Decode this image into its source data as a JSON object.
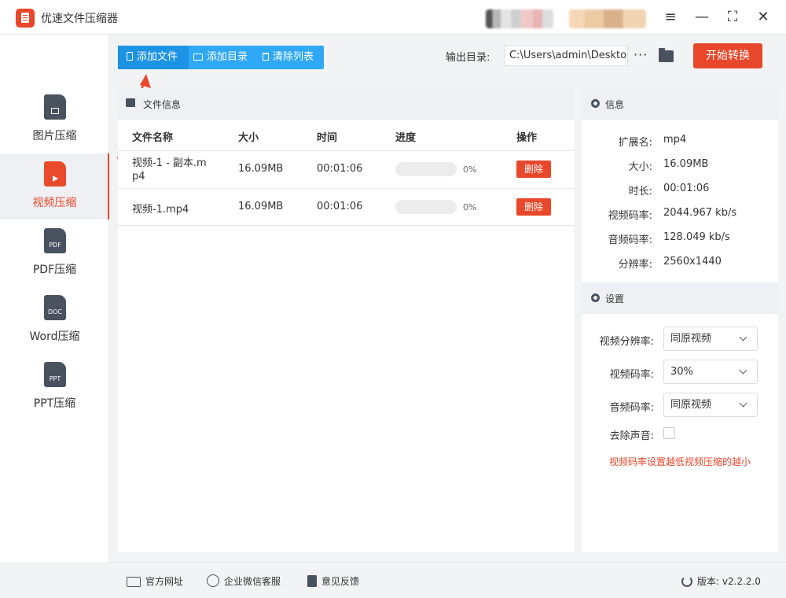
{
  "app": {
    "title": "优速文件压缩器"
  },
  "window": {
    "menu_icon": "≡",
    "minimize_icon": "—",
    "maximize_icon": "⛶",
    "close_icon": "✕"
  },
  "sidebar": {
    "items": [
      {
        "label": "图片压缩",
        "icon": "image-file-icon",
        "active": false
      },
      {
        "label": "视频压缩",
        "icon": "video-file-icon",
        "active": true
      },
      {
        "label": "PDF压缩",
        "icon": "pdf-file-icon",
        "tag": "PDF",
        "active": false
      },
      {
        "label": "Word压缩",
        "icon": "doc-file-icon",
        "tag": "DOC",
        "active": false
      },
      {
        "label": "PPT压缩",
        "icon": "ppt-file-icon",
        "tag": "PPT",
        "active": false
      }
    ]
  },
  "toolbar": {
    "add_file": "添加文件",
    "add_dir": "添加目录",
    "clear_list": "清除列表",
    "output_label": "输出目录:",
    "output_path": "C:\\Users\\admin\\Deskto",
    "more": "···",
    "start": "开始转换"
  },
  "file_panel": {
    "title": "文件信息",
    "columns": [
      "文件名称",
      "大小",
      "时间",
      "进度",
      "操作"
    ],
    "rows": [
      {
        "name_line1": "视频-1 - 副本.m",
        "name_line2": "p4",
        "size": "16.09MB",
        "time": "00:01:06",
        "progress": 0,
        "progress_text": "0%",
        "action": "删除"
      },
      {
        "name_line1": "视频-1.mp4",
        "size": "16.09MB",
        "time": "00:01:06",
        "progress": 0,
        "progress_text": "0%",
        "action": "删除"
      }
    ]
  },
  "info": {
    "title": "信息",
    "fields": [
      {
        "key": "扩展名:",
        "value": "mp4"
      },
      {
        "key": "大小:",
        "value": "16.09MB"
      },
      {
        "key": "时长:",
        "value": "00:01:06"
      },
      {
        "key": "视频码率:",
        "value": "2044.967 kb/s"
      },
      {
        "key": "音频码率:",
        "value": "128.049 kb/s"
      },
      {
        "key": "分辨率:",
        "value": "2560x1440"
      }
    ]
  },
  "settings": {
    "title": "设置",
    "video_resolution": {
      "label": "视频分辨率:",
      "value": "同原视频"
    },
    "video_bitrate": {
      "label": "视频码率:",
      "value": "30%"
    },
    "audio_bitrate": {
      "label": "音频码率:",
      "value": "同原视频"
    },
    "remove_audio": {
      "label": "去除声音:",
      "checked": false
    },
    "note": "视频码率设置越低视频压缩的越小"
  },
  "statusbar": {
    "website": "官方网址",
    "wechat": "企业微信客服",
    "feedback": "意见反馈",
    "version": "版本: v2.2.2.0"
  },
  "colors": {
    "accent": "#e9472b",
    "blue": "#2fa8f5",
    "icon": "#4a5260"
  }
}
